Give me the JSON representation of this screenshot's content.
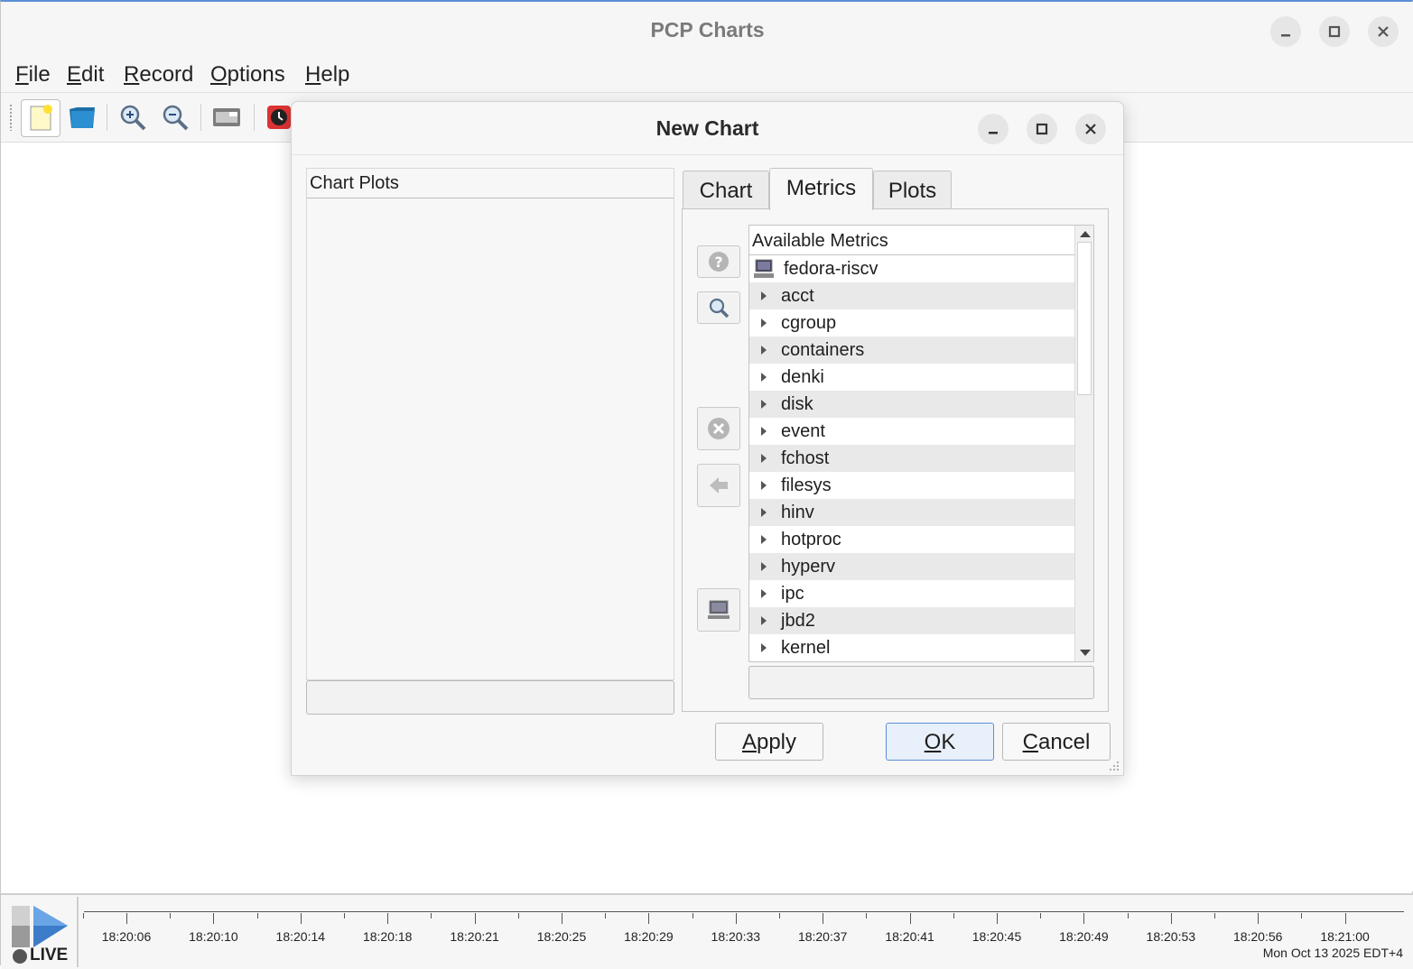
{
  "window": {
    "title": "PCP Charts"
  },
  "menu": {
    "items": [
      {
        "label": "File",
        "mnemonic": "F",
        "rest": "ile"
      },
      {
        "label": "Edit",
        "mnemonic": "E",
        "rest": "dit"
      },
      {
        "label": "Record",
        "mnemonic": "R",
        "rest": "ecord"
      },
      {
        "label": "Options",
        "mnemonic": "O",
        "rest": "ptions"
      },
      {
        "label": "Help",
        "mnemonic": "H",
        "rest": "elp"
      }
    ]
  },
  "toolbar": {
    "icons": [
      "new-chart-icon",
      "open-view-icon",
      "zoom-in-icon",
      "zoom-out-icon",
      "export-image-icon",
      "record-clock-icon"
    ]
  },
  "dialog": {
    "title": "New Chart",
    "chart_plots_header": "Chart Plots",
    "tabs": [
      {
        "label": "Chart",
        "active": false
      },
      {
        "label": "Metrics",
        "active": true
      },
      {
        "label": "Plots",
        "active": false
      }
    ],
    "tree_header": "Available Metrics",
    "host": "fedora-riscv",
    "metrics": [
      "acct",
      "cgroup",
      "containers",
      "denki",
      "disk",
      "event",
      "fchost",
      "filesys",
      "hinv",
      "hotproc",
      "hyperv",
      "ipc",
      "jbd2",
      "kernel"
    ],
    "buttons": {
      "apply": {
        "label": "Apply",
        "mnemonic": "A",
        "rest": "pply"
      },
      "ok": {
        "label": "OK",
        "mnemonic": "O",
        "rest": "K"
      },
      "cancel": {
        "label": "Cancel",
        "mnemonic": "C",
        "rest": "ancel"
      }
    },
    "side_buttons": [
      "metric-info-icon",
      "search-metric-icon",
      "remove-plot-icon",
      "add-plot-arrow-icon",
      "add-host-icon"
    ]
  },
  "timeline": {
    "live_label": "LIVE",
    "ticks": [
      "18:20:06",
      "18:20:10",
      "18:20:14",
      "18:20:18",
      "18:20:21",
      "18:20:25",
      "18:20:29",
      "18:20:33",
      "18:20:37",
      "18:20:41",
      "18:20:45",
      "18:20:49",
      "18:20:53",
      "18:20:56",
      "18:21:00"
    ],
    "date": "Mon Oct 13 2025 EDT+4"
  }
}
